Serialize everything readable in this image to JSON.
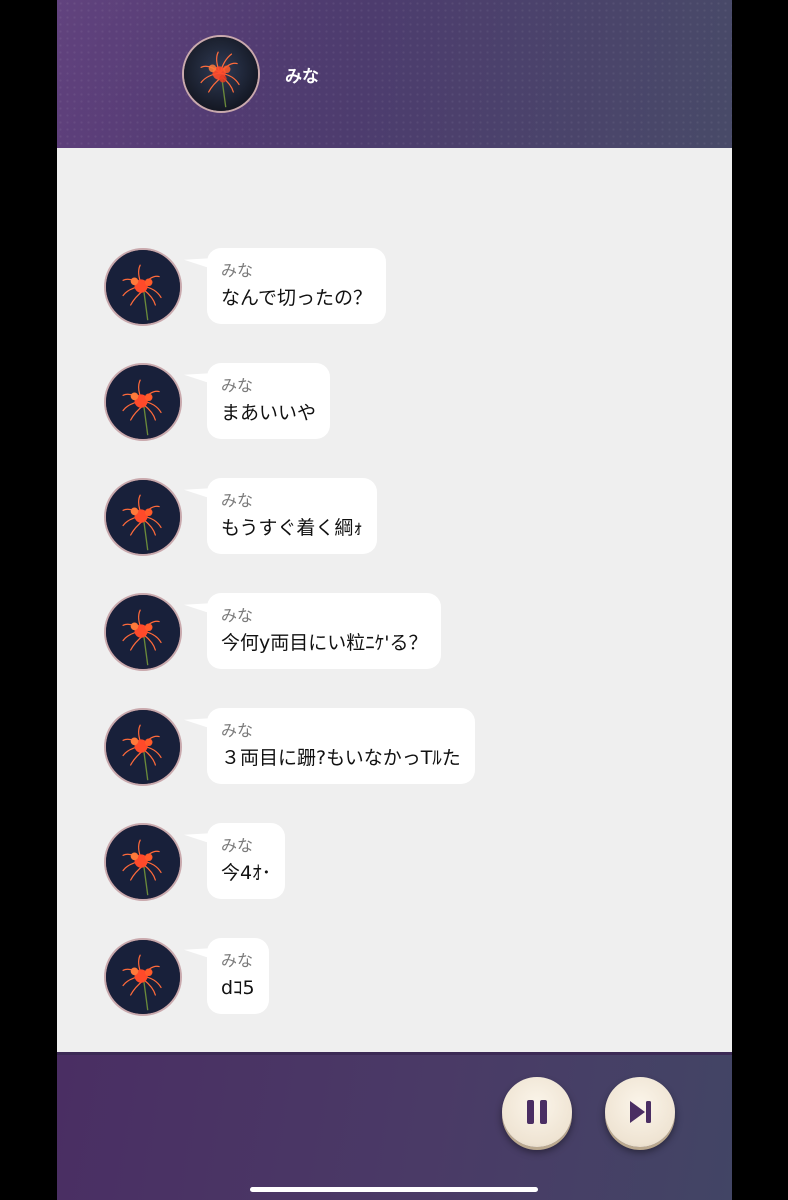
{
  "header": {
    "contact_name": "みな",
    "avatar_icon": "spider-lily-avatar-icon"
  },
  "messages": [
    {
      "sender": "みな",
      "text": "なんで切ったの？"
    },
    {
      "sender": "みな",
      "text": "まあいいや"
    },
    {
      "sender": "みな",
      "text": "もうすぐ着く綱ｫ"
    },
    {
      "sender": "みな",
      "text": "今何y両目にい粒ﾆｹ'る？"
    },
    {
      "sender": "みな",
      "text": "３両目に跚?もいなかっTﾙた"
    },
    {
      "sender": "みな",
      "text": "今4ｵ･"
    },
    {
      "sender": "みな",
      "text": "dｺ5"
    }
  ],
  "controls": {
    "pause_icon": "pause-icon",
    "skip_icon": "skip-forward-icon"
  },
  "colors": {
    "header_bg": "#4d3c6e",
    "chat_bg": "#efefef",
    "bubble_bg": "#ffffff",
    "sender_text": "#7a7a7a",
    "footer_bg": "#4a3a66",
    "button_bg": "#f3eadb"
  }
}
